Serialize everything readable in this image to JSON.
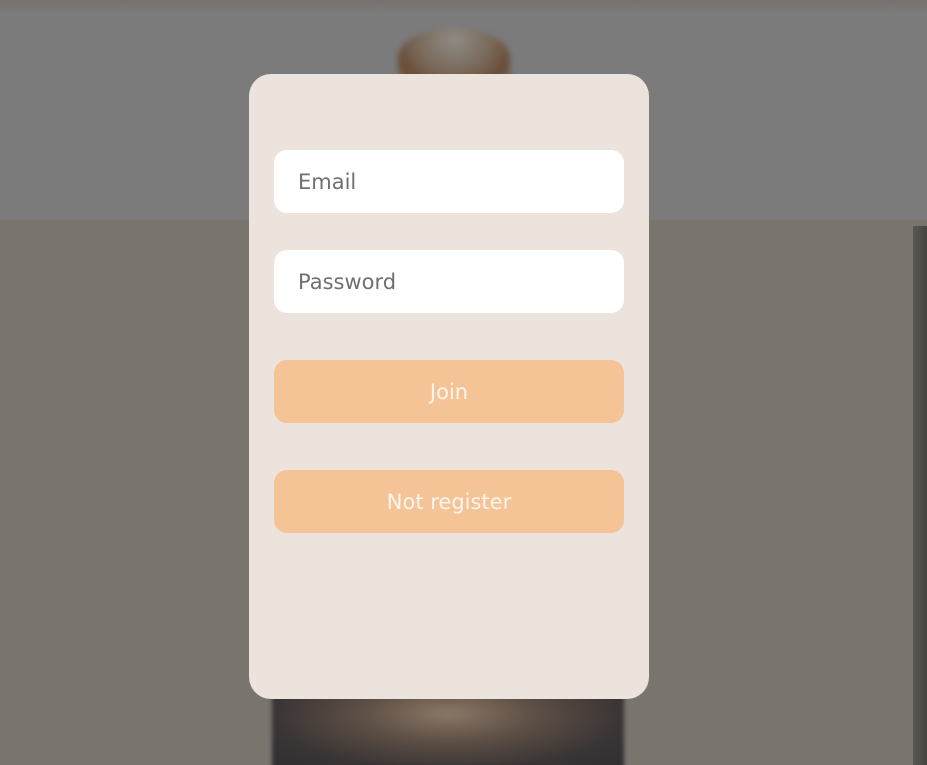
{
  "login_form": {
    "email_placeholder": "Email",
    "password_placeholder": "Password",
    "join_label": "Join",
    "register_label": "Not register"
  },
  "colors": {
    "card_background": "#ebe3dc",
    "button_background": "#f5c496",
    "button_text": "#fbf5ee",
    "backdrop": "#79746e"
  }
}
